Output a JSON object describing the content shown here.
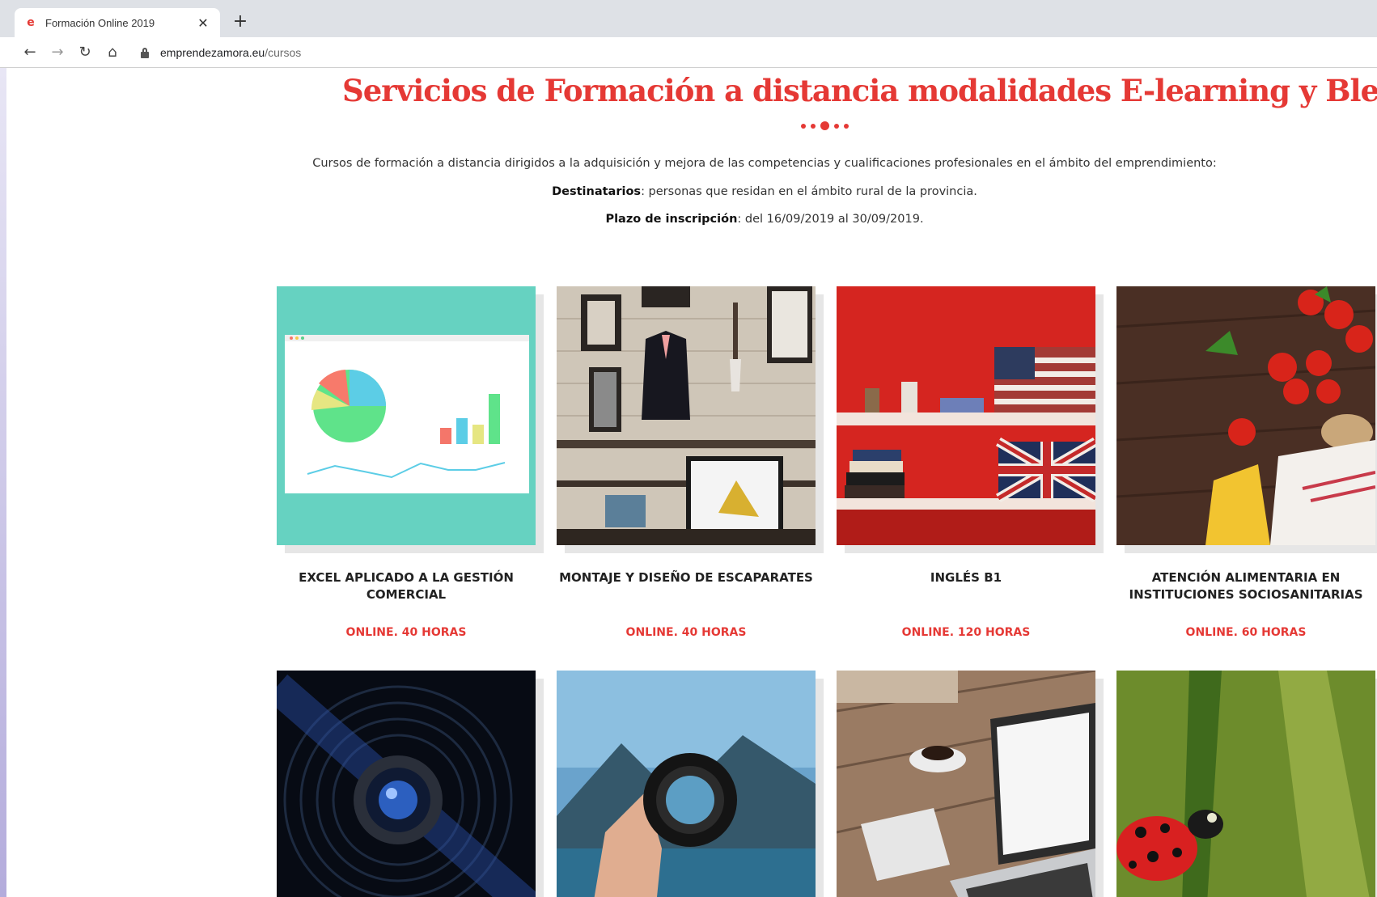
{
  "browser": {
    "tab_title": "Formación Online 2019",
    "tab_close": "✕",
    "new_tab": "+",
    "url_host": "emprendezamora.eu",
    "url_path": "/cursos",
    "nav": {
      "back": "←",
      "forward": "→",
      "reload": "↻",
      "home": "⌂"
    }
  },
  "page": {
    "headline": "Servicios de Formación a distancia modalidades E-learning y Blended Learning.",
    "intro": "Cursos de formación a distancia dirigidos a la adquisición y mejora de las competencias y cualificaciones profesionales en el ámbito del emprendimiento:",
    "destinatarios_label": "Destinatarios",
    "destinatarios_text": ": personas que residan en el ámbito rural de la provincia.",
    "plazo_label": "Plazo de inscripción",
    "plazo_text": ": del 16/09/2019 al 30/09/2019."
  },
  "courses": [
    {
      "title": "EXCEL APLICADO A LA GESTIÓN COMERCIAL",
      "meta": "ONLINE. 40 HORAS"
    },
    {
      "title": "MONTAJE Y DISEÑO DE ESCAPARATES",
      "meta": "ONLINE. 40 HORAS"
    },
    {
      "title": "INGLÉS B1",
      "meta": "ONLINE. 120 HORAS"
    },
    {
      "title": "ATENCIÓN ALIMENTARIA EN INSTITUCIONES SOCIOSANITARIAS",
      "meta": "ONLINE. 60 HORAS"
    }
  ],
  "colors": {
    "accent": "#e53935",
    "card_shadow": "#e6e6e6"
  }
}
